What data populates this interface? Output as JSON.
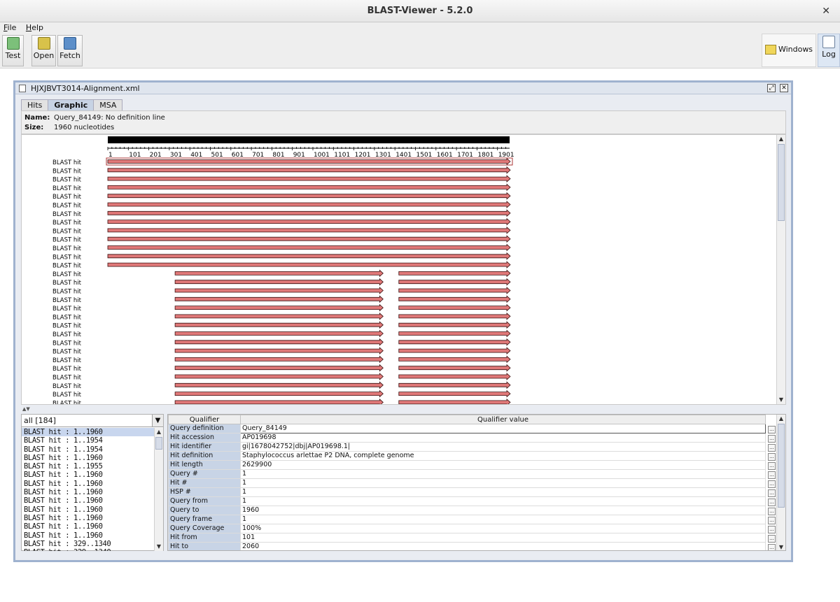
{
  "window": {
    "title": "BLAST-Viewer - 5.2.0",
    "close": "✕"
  },
  "menu": {
    "items": [
      "File",
      "Help"
    ]
  },
  "toolbar": {
    "test_label": "Test",
    "open_label": "Open",
    "fetch_label": "Fetch",
    "windows_label": "Windows",
    "log_label": "Log"
  },
  "internal_frame": {
    "title": "HJXJBVT3014-Alignment.xml",
    "tabs": [
      "Hits",
      "Graphic",
      "MSA"
    ],
    "active_tab": "Graphic"
  },
  "info": {
    "name_label": "Name:",
    "name_value": "Query_84149: No definition line",
    "size_label": "Size:",
    "size_value": "1960 nucleotides"
  },
  "graphic": {
    "ruler_ticks": [
      "1",
      "101",
      "201",
      "301",
      "401",
      "501",
      "601",
      "701",
      "801",
      "901",
      "1001",
      "1101",
      "1201",
      "1301",
      "1401",
      "1501",
      "1601",
      "1701",
      "1801",
      "1901"
    ],
    "query_length": 1960,
    "hit_label": "BLAST hit",
    "hit_color": "#e07878",
    "hits": [
      [
        [
          1,
          1960
        ]
      ],
      [
        [
          1,
          1960
        ]
      ],
      [
        [
          1,
          1960
        ]
      ],
      [
        [
          1,
          1960
        ]
      ],
      [
        [
          1,
          1960
        ]
      ],
      [
        [
          1,
          1960
        ]
      ],
      [
        [
          1,
          1960
        ]
      ],
      [
        [
          1,
          1960
        ]
      ],
      [
        [
          1,
          1960
        ]
      ],
      [
        [
          1,
          1960
        ]
      ],
      [
        [
          1,
          1960
        ]
      ],
      [
        [
          1,
          1960
        ]
      ],
      [
        [
          1,
          1960
        ]
      ],
      [
        [
          329,
          1340
        ],
        [
          1420,
          1960
        ]
      ],
      [
        [
          329,
          1340
        ],
        [
          1420,
          1960
        ]
      ],
      [
        [
          329,
          1340
        ],
        [
          1420,
          1960
        ]
      ],
      [
        [
          329,
          1340
        ],
        [
          1420,
          1960
        ]
      ],
      [
        [
          329,
          1340
        ],
        [
          1420,
          1960
        ]
      ],
      [
        [
          329,
          1340
        ],
        [
          1420,
          1960
        ]
      ],
      [
        [
          329,
          1340
        ],
        [
          1420,
          1960
        ]
      ],
      [
        [
          329,
          1340
        ],
        [
          1420,
          1960
        ]
      ],
      [
        [
          329,
          1340
        ],
        [
          1420,
          1960
        ]
      ],
      [
        [
          329,
          1340
        ],
        [
          1420,
          1960
        ]
      ],
      [
        [
          329,
          1340
        ],
        [
          1420,
          1960
        ]
      ],
      [
        [
          329,
          1340
        ],
        [
          1420,
          1960
        ]
      ],
      [
        [
          329,
          1340
        ],
        [
          1420,
          1960
        ]
      ],
      [
        [
          329,
          1340
        ],
        [
          1420,
          1960
        ]
      ],
      [
        [
          329,
          1340
        ],
        [
          1420,
          1960
        ]
      ],
      [
        [
          329,
          1340
        ],
        [
          1420,
          1960
        ]
      ]
    ]
  },
  "filter": {
    "selected": "all [184]"
  },
  "hit_list": [
    "BLAST hit : 1..1960",
    "BLAST hit : 1..1954",
    "BLAST hit : 1..1954",
    "BLAST hit : 1..1960",
    "BLAST hit : 1..1955",
    "BLAST hit : 1..1960",
    "BLAST hit : 1..1960",
    "BLAST hit : 1..1960",
    "BLAST hit : 1..1960",
    "BLAST hit : 1..1960",
    "BLAST hit : 1..1960",
    "BLAST hit : 1..1960",
    "BLAST hit : 1..1960",
    "BLAST hit : 329..1340",
    "BLAST hit : 329..1340"
  ],
  "qualifiers": {
    "headers": [
      "Qualifier",
      "Qualifier value"
    ],
    "rows": [
      [
        "Query definition",
        "Query_84149"
      ],
      [
        "Hit accession",
        "AP019698"
      ],
      [
        "Hit identifier",
        "gi|1678042752|dbj|AP019698.1|"
      ],
      [
        "Hit definition",
        "Staphylococcus arlettae P2 DNA, complete genome"
      ],
      [
        "Hit length",
        "2629900"
      ],
      [
        "Query #",
        "1"
      ],
      [
        "Hit #",
        "1"
      ],
      [
        "HSP #",
        "1"
      ],
      [
        "Query from",
        "1"
      ],
      [
        "Query to",
        "1960"
      ],
      [
        "Query frame",
        "1"
      ],
      [
        "Query Coverage",
        "100%"
      ],
      [
        "Hit from",
        "101"
      ],
      [
        "Hit to",
        "2060"
      ]
    ]
  }
}
